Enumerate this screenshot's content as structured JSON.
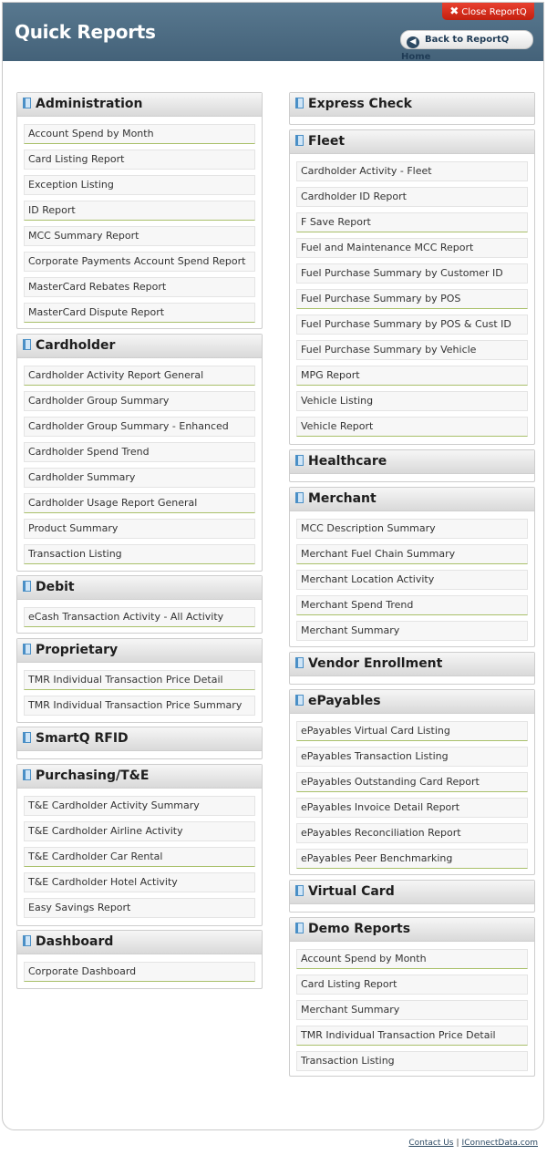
{
  "header": {
    "title": "Quick Reports",
    "close_label": "Close ReportQ",
    "back_label": "Back to ReportQ Home"
  },
  "panels": [
    {
      "title": "Administration",
      "items": [
        "Account Spend by Month",
        "Card Listing Report",
        "Exception Listing",
        "ID Report",
        "MCC Summary Report",
        "Corporate Payments Account Spend Report",
        "MasterCard Rebates Report",
        "MasterCard Dispute Report"
      ]
    },
    {
      "title": "Cardholder",
      "items": [
        "Cardholder Activity Report General",
        "Cardholder Group Summary",
        "Cardholder Group Summary - Enhanced",
        "Cardholder Spend Trend",
        "Cardholder Summary",
        "Cardholder Usage Report General",
        "Product Summary",
        "Transaction Listing"
      ]
    },
    {
      "title": "Debit",
      "items": [
        "eCash Transaction Activity - All Activity"
      ]
    },
    {
      "title": "Proprietary",
      "items": [
        "TMR Individual Transaction Price Detail",
        "TMR Individual Transaction Price Summary"
      ]
    },
    {
      "title": "SmartQ RFID",
      "items": []
    },
    {
      "title": "Purchasing/T&E",
      "items": [
        "T&E Cardholder Activity Summary",
        "T&E Cardholder Airline Activity",
        "T&E Cardholder Car Rental",
        "T&E Cardholder Hotel Activity",
        "Easy Savings Report"
      ]
    },
    {
      "title": "Dashboard",
      "items": [
        "Corporate Dashboard"
      ]
    },
    {
      "title": "Express Check",
      "items": []
    },
    {
      "title": "Fleet",
      "items": [
        "Cardholder Activity - Fleet",
        "Cardholder ID Report",
        "F Save Report",
        "Fuel and Maintenance MCC Report",
        "Fuel Purchase Summary by Customer ID",
        "Fuel Purchase Summary by POS",
        "Fuel Purchase Summary by POS & Cust ID",
        "Fuel Purchase Summary by Vehicle",
        "MPG Report",
        "Vehicle Listing",
        "Vehicle Report"
      ]
    },
    {
      "title": "Healthcare",
      "items": []
    },
    {
      "title": "Merchant",
      "items": [
        "MCC Description Summary",
        "Merchant Fuel Chain Summary",
        "Merchant Location Activity",
        "Merchant Spend Trend",
        "Merchant Summary"
      ]
    },
    {
      "title": "Vendor Enrollment",
      "items": []
    },
    {
      "title": "ePayables",
      "items": [
        "ePayables Virtual Card Listing",
        "ePayables Transaction Listing",
        "ePayables Outstanding Card Report",
        "ePayables Invoice Detail Report",
        "ePayables Reconciliation Report",
        "ePayables Peer Benchmarking"
      ]
    },
    {
      "title": "Virtual Card",
      "items": []
    },
    {
      "title": "Demo Reports",
      "items": [
        "Account Spend by Month",
        "Card Listing Report",
        "Merchant Summary",
        "TMR Individual Transaction Price Detail",
        "Transaction Listing"
      ]
    }
  ],
  "footer": {
    "contact_label": "Contact Us",
    "separator": "|",
    "site_label": "IConnectData.com"
  }
}
